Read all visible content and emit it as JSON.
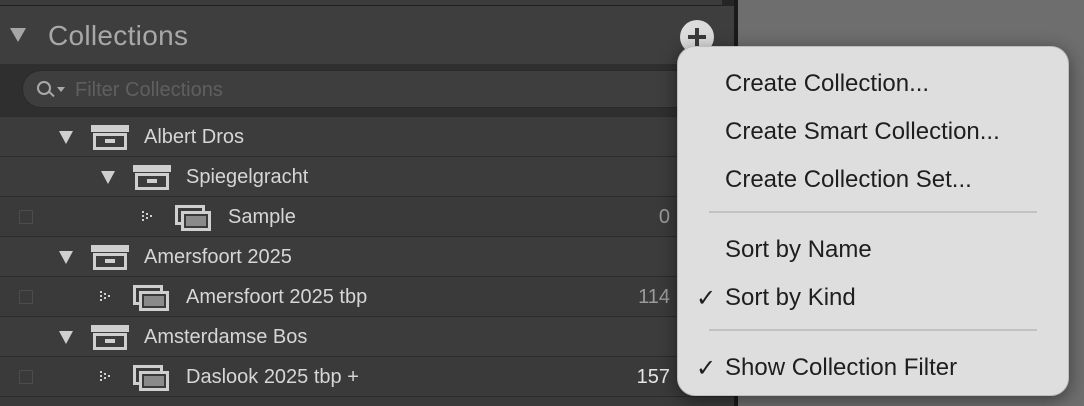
{
  "panel": {
    "title": "Collections",
    "filter_placeholder": "Filter Collections",
    "filter_value": ""
  },
  "tree": [
    {
      "kind": "set",
      "label": "Albert Dros",
      "expanded": true
    },
    {
      "kind": "set",
      "label": "Spiegelgracht",
      "expanded": true
    },
    {
      "kind": "collection",
      "label": "Sample",
      "count": "0"
    },
    {
      "kind": "set",
      "label": "Amersfoort 2025",
      "expanded": true
    },
    {
      "kind": "collection",
      "label": "Amersfoort 2025 tbp",
      "count": "114"
    },
    {
      "kind": "set",
      "label": "Amsterdamse Bos",
      "expanded": true
    },
    {
      "kind": "collection",
      "label": "Daslook 2025 tbp",
      "plus": "+",
      "count": "157"
    }
  ],
  "menu": {
    "create_collection": "Create Collection...",
    "create_smart_collection": "Create Smart Collection...",
    "create_collection_set": "Create Collection Set...",
    "sort_by_name": "Sort by Name",
    "sort_by_kind": "Sort by Kind",
    "show_collection_filter": "Show Collection Filter",
    "checkmark": "✓"
  },
  "icons": {
    "add": "plus-icon",
    "search": "search-icon",
    "collection_set": "collection-set-icon",
    "collection": "collection-icon"
  }
}
